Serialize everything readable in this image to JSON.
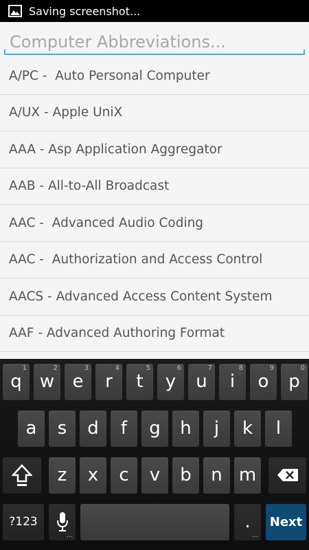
{
  "status_bar": {
    "icon": "image-icon",
    "text": "Saving screenshot..."
  },
  "search": {
    "placeholder": "Computer Abbreviations...",
    "value": "",
    "accent_color": "#33b5e5"
  },
  "list": [
    "A/PC -  Auto Personal Computer",
    "A/UX - Apple UniX",
    "AAA - Asp Application Aggregator",
    "AAB - All-to-All Broadcast",
    "AAC -  Advanced Audio Coding",
    "AAC -  Authorization and Access Control",
    "AACS - Advanced Access Content System",
    "AAF - Advanced Authoring Format"
  ],
  "keyboard": {
    "row1": [
      {
        "label": "q",
        "hint": "1"
      },
      {
        "label": "w",
        "hint": "2"
      },
      {
        "label": "e",
        "hint": "3"
      },
      {
        "label": "r",
        "hint": "4"
      },
      {
        "label": "t",
        "hint": "5"
      },
      {
        "label": "y",
        "hint": "6"
      },
      {
        "label": "u",
        "hint": "7"
      },
      {
        "label": "i",
        "hint": "8"
      },
      {
        "label": "o",
        "hint": "9"
      },
      {
        "label": "p",
        "hint": "0"
      }
    ],
    "row2": [
      "a",
      "s",
      "d",
      "f",
      "g",
      "h",
      "j",
      "k",
      "l"
    ],
    "row3": [
      "z",
      "x",
      "c",
      "v",
      "b",
      "n",
      "m"
    ],
    "symbols_label": "?123",
    "period_label": ".",
    "period_hint": "...",
    "mic_hint": "...",
    "next_label": "Next",
    "next_color": "#0e4a73"
  }
}
